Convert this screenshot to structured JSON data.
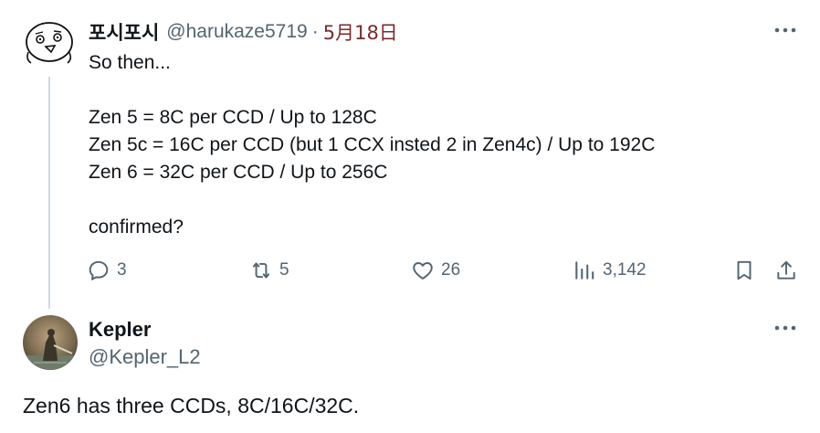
{
  "tweet1": {
    "display_name": "포시포시",
    "handle": "@harukaze5719",
    "separator": "·",
    "date": "5月18日",
    "lines": [
      "So then...",
      "",
      "Zen 5 = 8C per CCD / Up to 128C",
      "Zen 5c = 16C per CCD (but 1 CCX insted 2 in Zen4c) / Up to 192C",
      "Zen 6 = 32C per CCD / Up to 256C",
      "",
      "confirmed?"
    ],
    "actions": {
      "replies": "3",
      "retweets": "5",
      "likes": "26",
      "views": "3,142"
    },
    "icons": [
      "reply-icon",
      "retweet-icon",
      "like-icon",
      "views-icon",
      "bookmark-icon",
      "share-icon",
      "more-icon"
    ]
  },
  "tweet2": {
    "display_name": "Kepler",
    "handle": "@Kepler_L2",
    "text": "Zen6 has three CCDs, 8C/16C/32C."
  },
  "colors": {
    "text": "#0f1419",
    "secondary": "#536471",
    "date": "#7a2a2a",
    "thread_line": "#cfd9de"
  }
}
